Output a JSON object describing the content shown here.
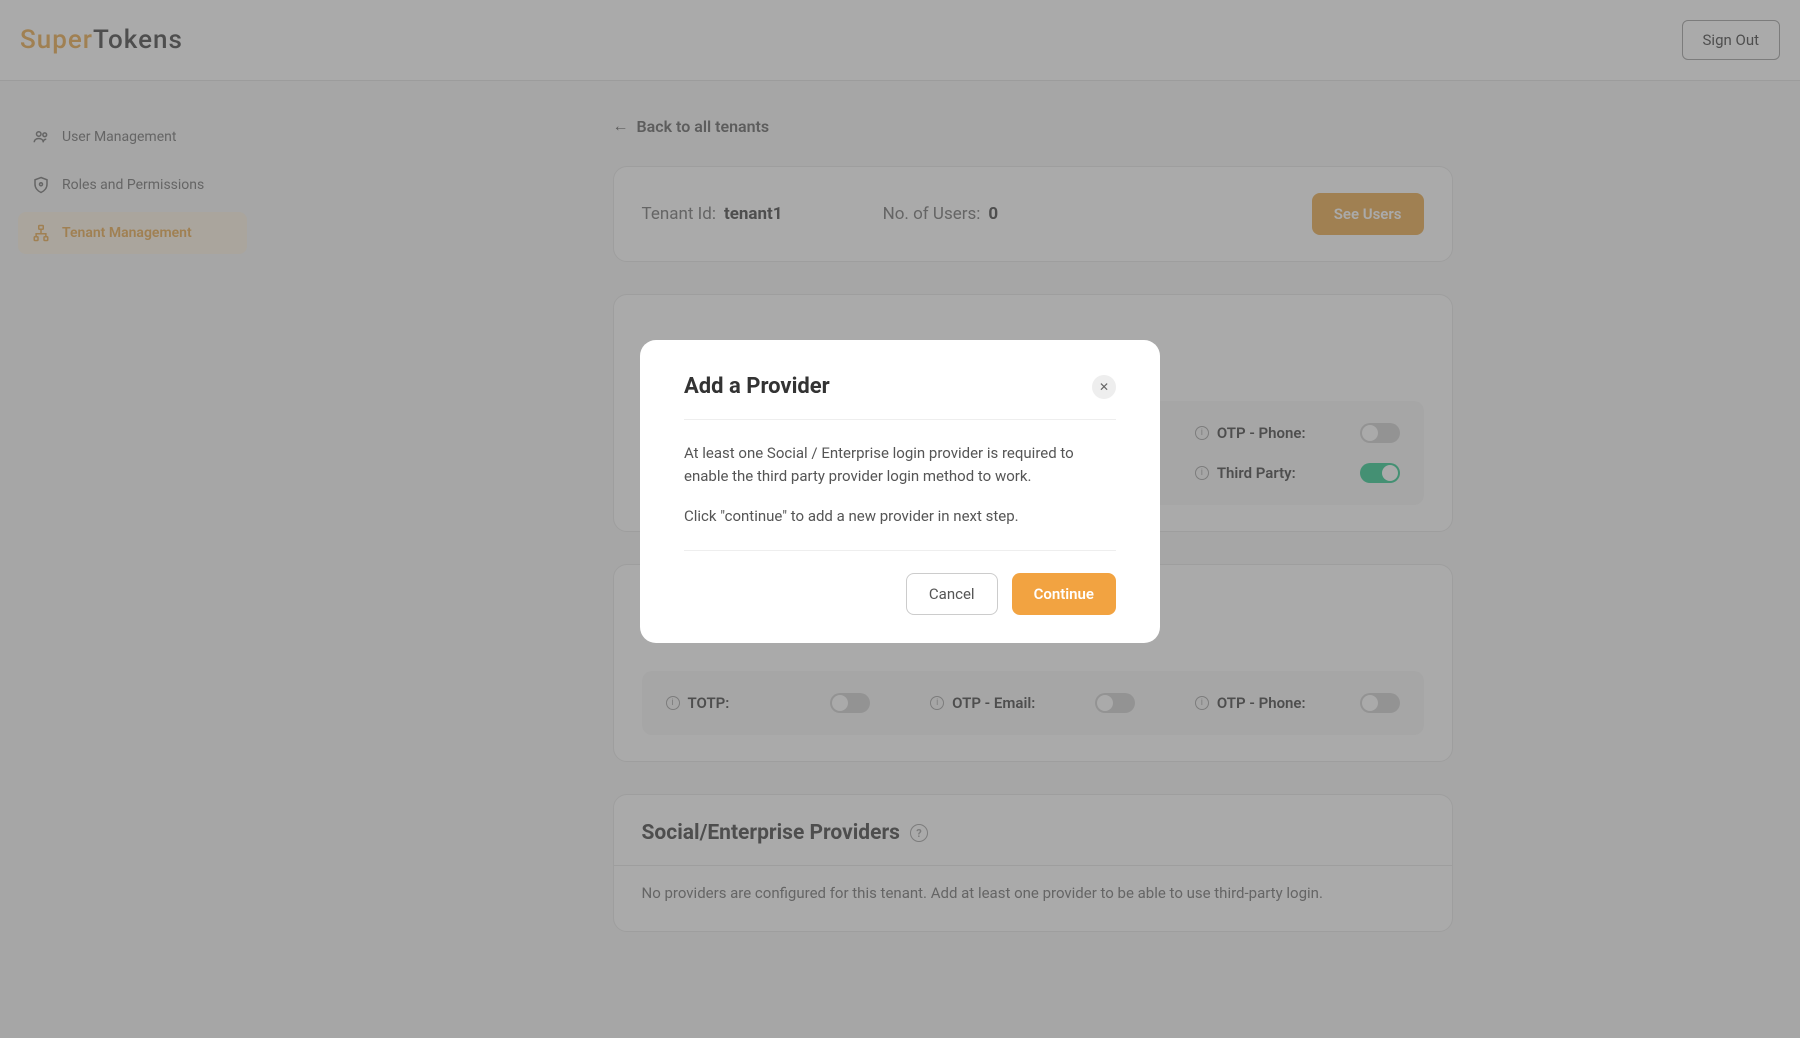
{
  "header": {
    "logo_part1": "Super",
    "logo_part2": "Tokens",
    "sign_out": "Sign Out"
  },
  "sidebar": {
    "items": [
      {
        "label": "User Management"
      },
      {
        "label": "Roles and Permissions"
      },
      {
        "label": "Tenant Management"
      }
    ]
  },
  "back_link": "Back to all tenants",
  "tenant": {
    "id_label": "Tenant Id:",
    "id_value": "tenant1",
    "users_label": "No. of Users:",
    "users_value": "0",
    "see_users": "See Users"
  },
  "login_methods": {
    "otp_phone": "OTP - Phone:",
    "third_party": "Third Party:"
  },
  "mfa": {
    "totp": "TOTP:",
    "otp_email": "OTP - Email:",
    "otp_phone": "OTP - Phone:"
  },
  "providers": {
    "title": "Social/Enterprise Providers",
    "desc": "No providers are configured for this tenant. Add at least one provider to be able to use third-party login."
  },
  "modal": {
    "title": "Add a Provider",
    "body1": "At least one Social / Enterprise login provider is required to enable the third party provider login method to work.",
    "body2": "Click \"continue\" to add a new provider in next step.",
    "cancel": "Cancel",
    "continue": "Continue"
  }
}
